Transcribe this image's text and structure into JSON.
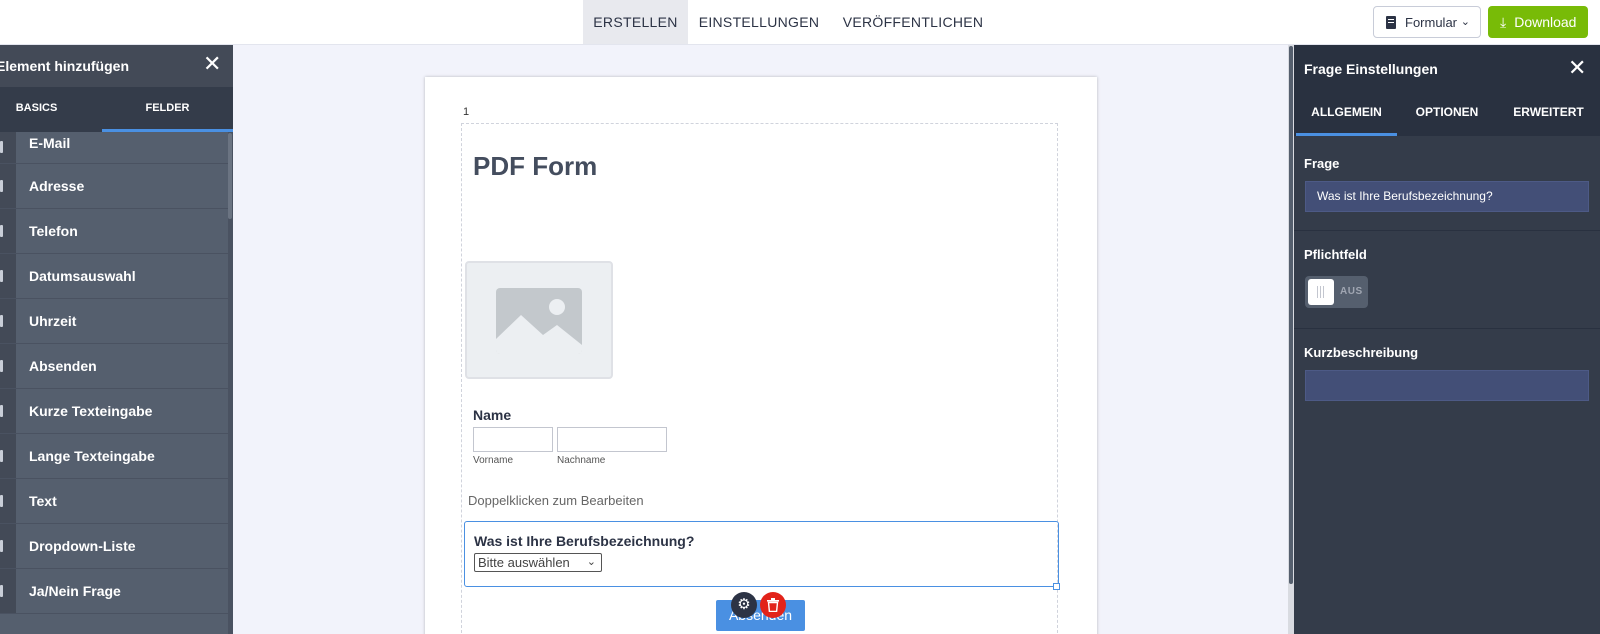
{
  "topbar": {
    "tabs": [
      "ERSTELLEN",
      "EINSTELLUNGEN",
      "VERÖFFENTLICHEN"
    ],
    "formular_label": "Formular",
    "download_label": "Download"
  },
  "left_panel": {
    "title": "Element hinzufügen",
    "tabs": [
      "BASICS",
      "FELDER"
    ],
    "active_tab": "FELDER",
    "items": [
      "E-Mail",
      "Adresse",
      "Telefon",
      "Datumsauswahl",
      "Uhrzeit",
      "Absenden",
      "Kurze Texteingabe",
      "Lange Texteingabe",
      "Text",
      "Dropdown-Liste",
      "Ja/Nein Frage"
    ]
  },
  "form": {
    "page_number": "1",
    "title": "PDF Form",
    "name_label": "Name",
    "first_name_sublabel": "Vorname",
    "last_name_sublabel": "Nachname",
    "edit_hint": "Doppelklicken zum Bearbeiten",
    "question": "Was ist Ihre Berufsbezeichnung?",
    "select_placeholder": "Bitte auswählen",
    "submit_label": "Absenden"
  },
  "right_panel": {
    "title": "Frage Einstellungen",
    "tabs": [
      "ALLGEMEIN",
      "OPTIONEN",
      "ERWEITERT"
    ],
    "active_tab": "ALLGEMEIN",
    "frage_label": "Frage",
    "frage_value": "Was ist Ihre Berufsbezeichnung?",
    "pflicht_label": "Pflichtfeld",
    "toggle_state": "AUS",
    "kurz_label": "Kurzbeschreibung",
    "kurz_value": ""
  },
  "colors": {
    "accent": "#4a90e2",
    "download": "#78bb07",
    "delete": "#e2231a",
    "panel_dark": "#343c4a"
  }
}
